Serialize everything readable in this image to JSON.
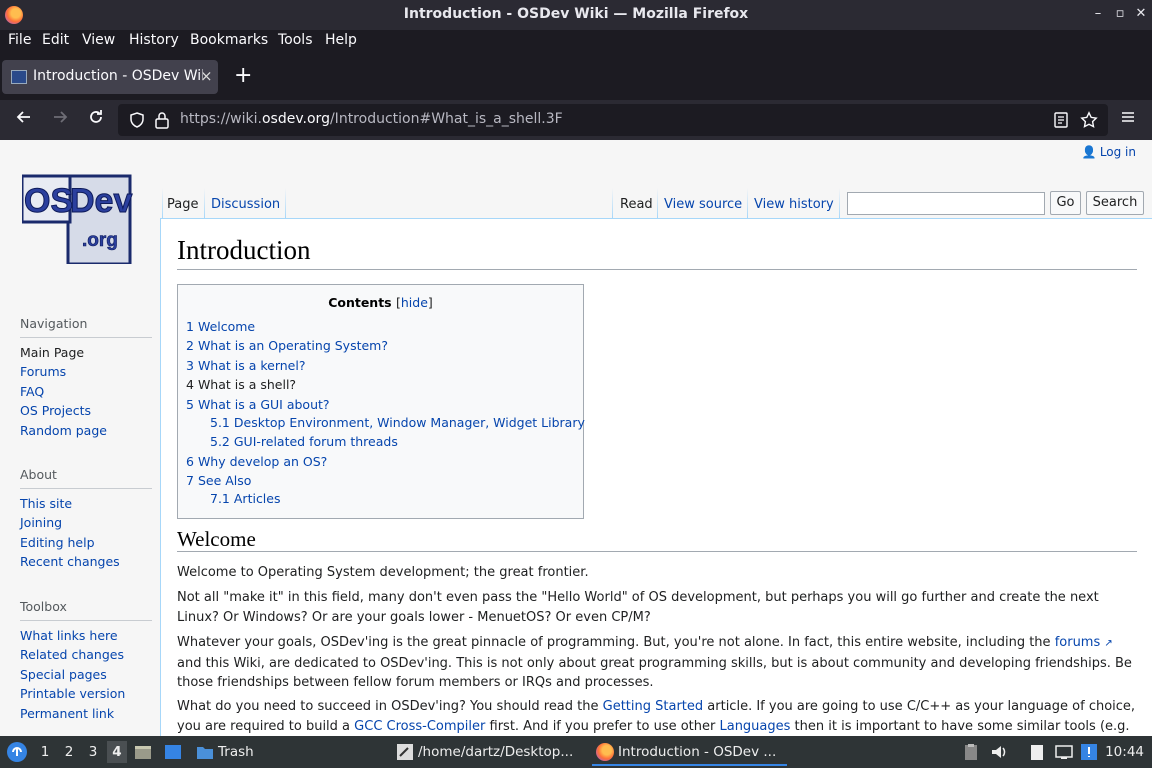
{
  "window": {
    "title": "Introduction - OSDev Wiki — Mozilla Firefox",
    "controls": [
      "–",
      "▫",
      "✕"
    ]
  },
  "menubar": {
    "items": [
      {
        "label": "File",
        "accel": "F"
      },
      {
        "label": "Edit",
        "accel": "E"
      },
      {
        "label": "View",
        "accel": "V"
      },
      {
        "label": "History",
        "accel": "s"
      },
      {
        "label": "Bookmarks",
        "accel": "B"
      },
      {
        "label": "Tools",
        "accel": "T"
      },
      {
        "label": "Help",
        "accel": "H"
      }
    ]
  },
  "tabs": [
    {
      "label": "Introduction - OSDev Wiki",
      "close": "×"
    }
  ],
  "newtab": "+",
  "urlbar": {
    "prefix": "https://wiki.",
    "domain": "osdev.org",
    "suffix": "/Introduction#What_is_a_shell.3F"
  },
  "wiki": {
    "login": "Log in",
    "logo": {
      "line1": "OS",
      "line2": "Dev",
      "line3": ".org"
    },
    "page_tabs": {
      "page": "Page",
      "discussion": "Discussion",
      "read": "Read",
      "view_source": "View source",
      "view_history": "View history"
    },
    "search": {
      "value": "",
      "go": "Go",
      "search": "Search"
    },
    "sidebar": {
      "sections": [
        {
          "heading": "Navigation",
          "links": [
            "Main Page",
            "Forums",
            "FAQ",
            "OS Projects",
            "Random page"
          ]
        },
        {
          "heading": "About",
          "links": [
            "This site",
            "Joining",
            "Editing help",
            "Recent changes"
          ]
        },
        {
          "heading": "Toolbox",
          "links": [
            "What links here",
            "Related changes",
            "Special pages",
            "Printable version",
            "Permanent link"
          ]
        }
      ]
    },
    "title": "Introduction",
    "toc": {
      "title": "Contents",
      "open": "[",
      "hide": "hide",
      "close": "]",
      "items": [
        {
          "num": "1",
          "text": "Welcome"
        },
        {
          "num": "2",
          "text": "What is an Operating System?"
        },
        {
          "num": "3",
          "text": "What is a kernel?"
        },
        {
          "num": "4",
          "text": "What is a shell?"
        },
        {
          "num": "5",
          "text": "What is a GUI about?"
        },
        {
          "num": "5.1",
          "text": "Desktop Environment, Window Manager, Widget Library"
        },
        {
          "num": "5.2",
          "text": "GUI-related forum threads"
        },
        {
          "num": "6",
          "text": "Why develop an OS?"
        },
        {
          "num": "7",
          "text": "See Also"
        },
        {
          "num": "7.1",
          "text": "Articles"
        }
      ]
    },
    "section_heading": "Welcome",
    "paragraphs": {
      "p1": "Welcome to Operating System development; the great frontier.",
      "p2": "Not all \"make it\" in this field, many don't even pass the \"Hello World\" of OS development, but perhaps you will go further and create the next Linux? Or Windows? Or are your goals lower - MenuetOS? Or even CP/M?",
      "p3a": "Whatever your goals, OSDev'ing is the great pinnacle of programming. But, you're not alone. In fact, this entire website, including the ",
      "p3link": "forums",
      "p3b": " and this Wiki, are dedicated to OSDev'ing. This is not only about great programming skills, but is about community and developing friendships. Be those friendships between fellow forum members or IRQs and processes.",
      "p4a": "What do you need to succeed in OSDev'ing? You should read the ",
      "p4link1": "Getting Started",
      "p4b": " article. If you are going to use C/C++ as your language of choice, you are required to build a ",
      "p4link2": "GCC Cross-Compiler",
      "p4c": " first. And if you prefer to use other ",
      "p4link3": "Languages",
      "p4d": " then it is important to have some similar tools (e.g."
    }
  },
  "taskbar": {
    "workspaces": [
      "1",
      "2",
      "3",
      "4"
    ],
    "active_workspace": "4",
    "trash": "Trash",
    "windows": [
      {
        "label": "/home/dartz/Desktop...",
        "active": false
      },
      {
        "label": "Introduction - OSDev ...",
        "active": true
      }
    ],
    "clock": "10:44"
  },
  "colors": {
    "link": "#0645ad",
    "chrome_dark": "#1c1b22",
    "accent": "#3584e4"
  }
}
